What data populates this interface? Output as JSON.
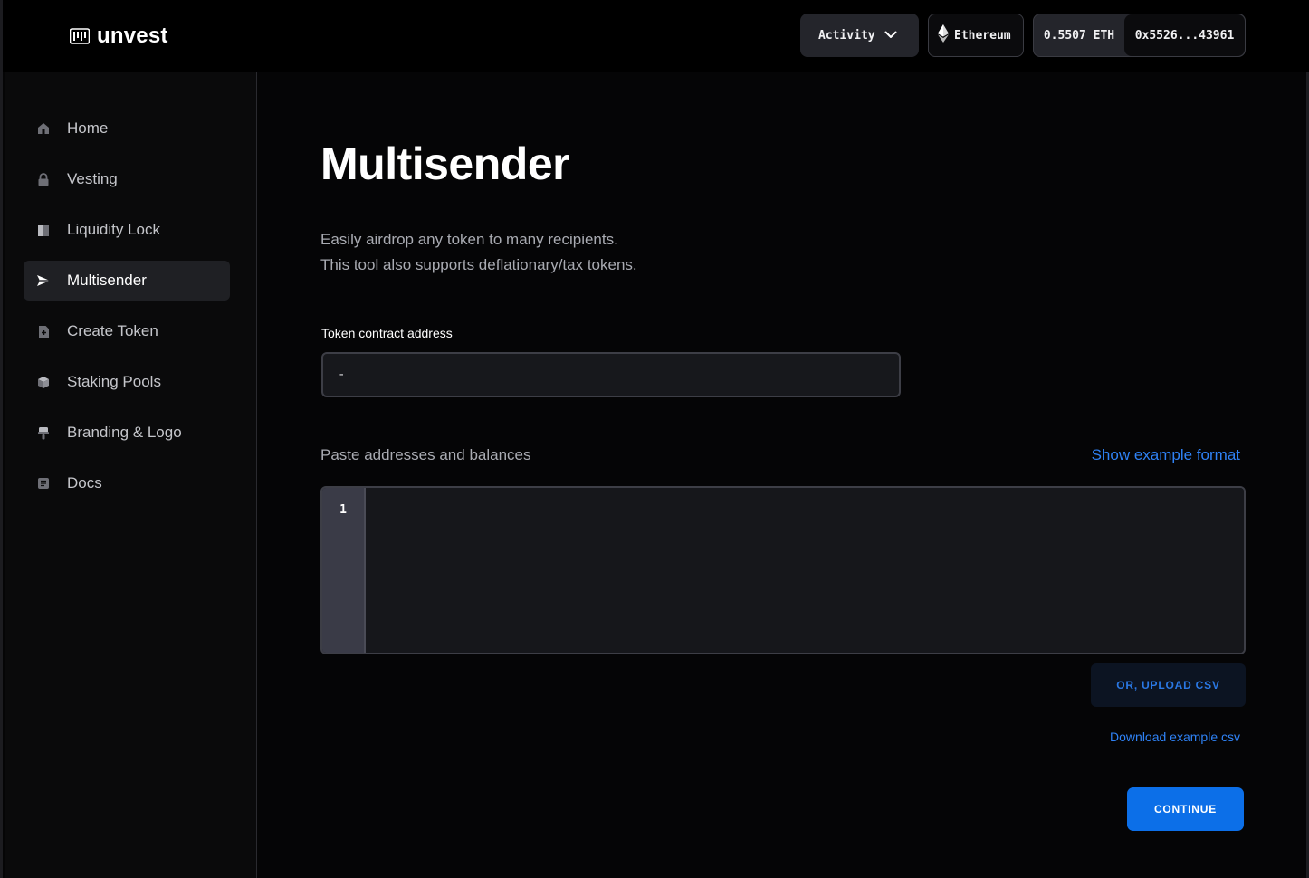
{
  "header": {
    "logo_text": "unvest",
    "activity_label": "Activity",
    "network_label": "Ethereum",
    "balance": "0.5507 ETH",
    "address": "0x5526...43961"
  },
  "sidebar": {
    "items": [
      {
        "label": "Home",
        "icon": "home-icon",
        "active": false
      },
      {
        "label": "Vesting",
        "icon": "lock-icon",
        "active": false
      },
      {
        "label": "Liquidity Lock",
        "icon": "liquidity-icon",
        "active": false
      },
      {
        "label": "Multisender",
        "icon": "send-icon",
        "active": true
      },
      {
        "label": "Create Token",
        "icon": "document-plus-icon",
        "active": false
      },
      {
        "label": "Staking Pools",
        "icon": "cube-icon",
        "active": false
      },
      {
        "label": "Branding & Logo",
        "icon": "brush-icon",
        "active": false
      },
      {
        "label": "Docs",
        "icon": "docs-icon",
        "active": false
      }
    ]
  },
  "main": {
    "title": "Multisender",
    "description_line1": "Easily airdrop any token to many recipients.",
    "description_line2": "This tool also supports deflationary/tax tokens.",
    "token_label": "Token contract address",
    "token_value": "-",
    "paste_label": "Paste addresses and balances",
    "show_example_link": "Show example format",
    "editor_line_number": "1",
    "editor_value": "",
    "upload_button": "OR, UPLOAD CSV",
    "download_link": "Download example csv",
    "continue_button": "CONTINUE"
  },
  "colors": {
    "background": "#050506",
    "accent": "#0c6fe8",
    "link": "#2f82f5"
  }
}
